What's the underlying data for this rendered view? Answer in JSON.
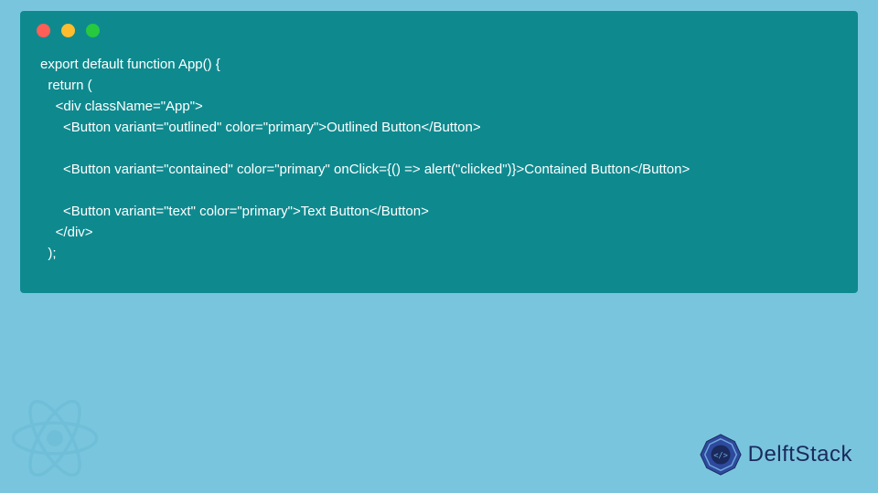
{
  "code_window": {
    "dots": [
      "red",
      "yellow",
      "green"
    ],
    "lines": [
      "export default function App() {",
      "  return (",
      "    <div className=\"App\">",
      "      <Button variant=\"outlined\" color=\"primary\">Outlined Button</Button>",
      "",
      "      <Button variant=\"contained\" color=\"primary\" onClick={() => alert(\"clicked\")}>Contained Button</Button>",
      "",
      "      <Button variant=\"text\" color=\"primary\">Text Button</Button>",
      "    </div>",
      "  );"
    ]
  },
  "brand": {
    "name": "DelftStack"
  },
  "colors": {
    "page_bg": "#7AC5DE",
    "code_bg": "#0E8A8F",
    "code_text": "#FFFFFF",
    "brand_text": "#1A2A5C"
  }
}
